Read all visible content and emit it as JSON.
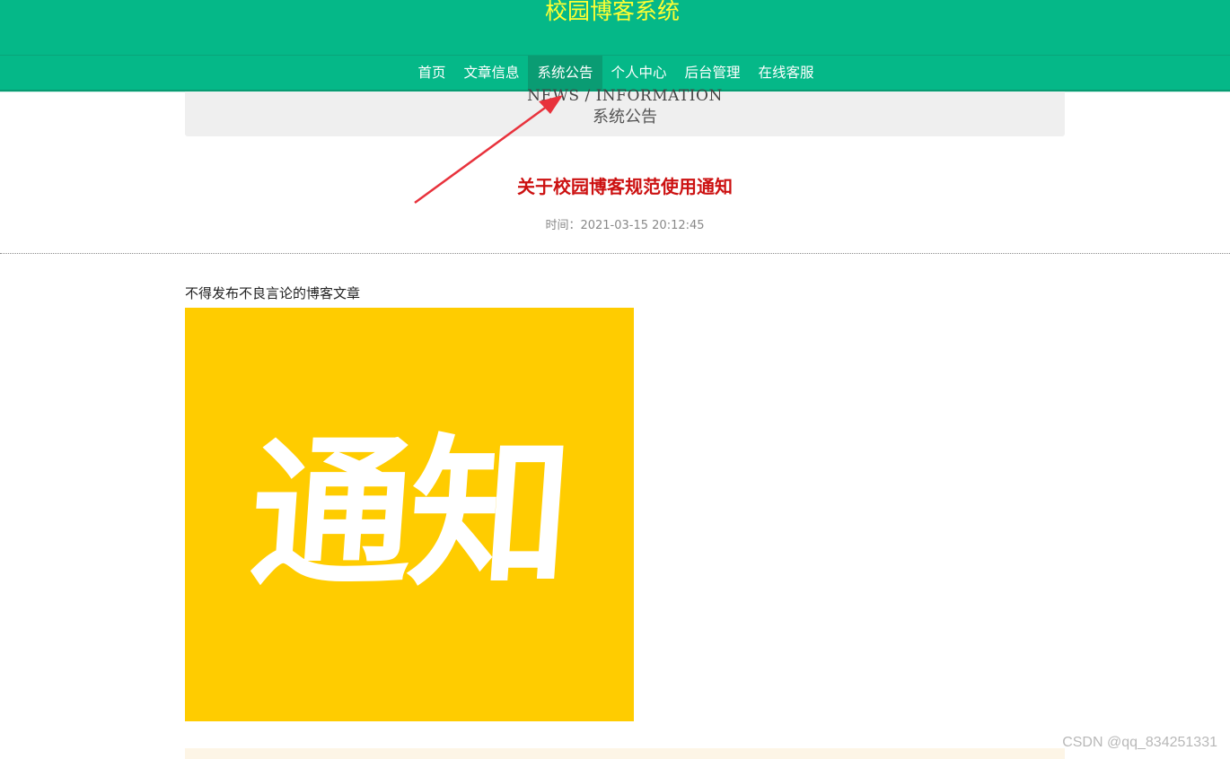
{
  "header": {
    "site_title": "校园博客系统",
    "nav_items": [
      "首页",
      "文章信息",
      "系统公告",
      "个人中心",
      "后台管理",
      "在线客服"
    ],
    "active_nav": "系统公告"
  },
  "banner": {
    "english": "NEWS / INFORMATION",
    "chinese": "系统公告"
  },
  "notice": {
    "title": "关于校园博客规范使用通知",
    "time_label": "时间：",
    "time_value": "2021-03-15 20:12:45",
    "content": "不得发布不良言论的博客文章",
    "image_text": "通知"
  },
  "watermark": "CSDN @qq_834251331",
  "colors": {
    "header_bg": "#05b888",
    "site_title": "#ffff33",
    "nav_active_bg": "#0a9c73",
    "notice_title": "#cc1111",
    "image_bg": "#ffcc00",
    "annotation_arrow": "#e8323c"
  }
}
